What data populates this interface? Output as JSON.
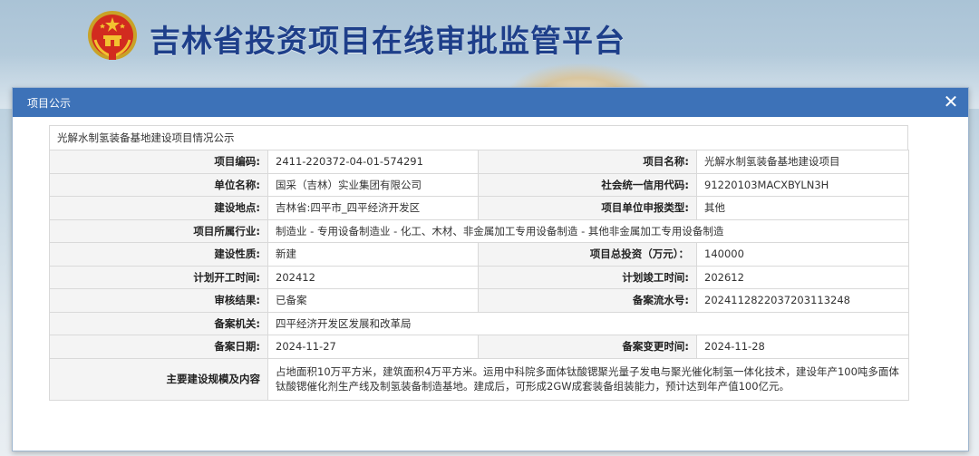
{
  "header": {
    "site_title": "吉林省投资项目在线审批监管平台",
    "emblem_icon": "national-emblem-icon"
  },
  "modal": {
    "title": "项目公示",
    "close_icon": "close-icon",
    "caption": "光解水制氢装备基地建设项目情况公示"
  },
  "fields": {
    "project_code": {
      "label": "项目编码:",
      "value": "2411-220372-04-01-574291"
    },
    "project_name": {
      "label": "项目名称:",
      "value": "光解水制氢装备基地建设项目"
    },
    "unit_name": {
      "label": "单位名称:",
      "value": "国采（吉林）实业集团有限公司"
    },
    "credit_code": {
      "label": "社会统一信用代码:",
      "value": "91220103MACXBYLN3H"
    },
    "location": {
      "label": "建设地点:",
      "value": "吉林省:四平市_四平经济开发区"
    },
    "unit_type": {
      "label": "项目单位申报类型:",
      "value": "其他"
    },
    "industry": {
      "label": "项目所属行业:",
      "value": "制造业 - 专用设备制造业 - 化工、木材、非金属加工专用设备制造 - 其他非金属加工专用设备制造"
    },
    "nature": {
      "label": "建设性质:",
      "value": "新建"
    },
    "total_investment": {
      "label": "项目总投资（万元）：",
      "value": "140000"
    },
    "start_time": {
      "label": "计划开工时间:",
      "value": "202412"
    },
    "finish_time": {
      "label": "计划竣工时间:",
      "value": "202612"
    },
    "review_result": {
      "label": "审核结果:",
      "value": "已备案"
    },
    "serial_no": {
      "label": "备案流水号:",
      "value": "2024112822037203113248"
    },
    "authority": {
      "label": "备案机关:",
      "value": "四平经济开发区发展和改革局"
    },
    "record_date": {
      "label": "备案日期:",
      "value": "2024-11-27"
    },
    "change_time": {
      "label": "备案变更时间:",
      "value": "2024-11-28"
    },
    "scale": {
      "label": "主要建设规模及内容",
      "value": "占地面积10万平方米，建筑面积4万平方米。运用中科院多面体钛酸锶聚光量子发电与聚光催化制氢一体化技术，建设年产100吨多面体钛酸锶催化剂生产线及制氢装备制造基地。建成后，可形成2GW成套装备组装能力，预计达到年产值100亿元。"
    }
  },
  "colors": {
    "title_blue": "#1e3f8a",
    "modal_header": "#3d72b8",
    "label_bg": "#f4f4f4",
    "border": "#d9d9d9"
  }
}
